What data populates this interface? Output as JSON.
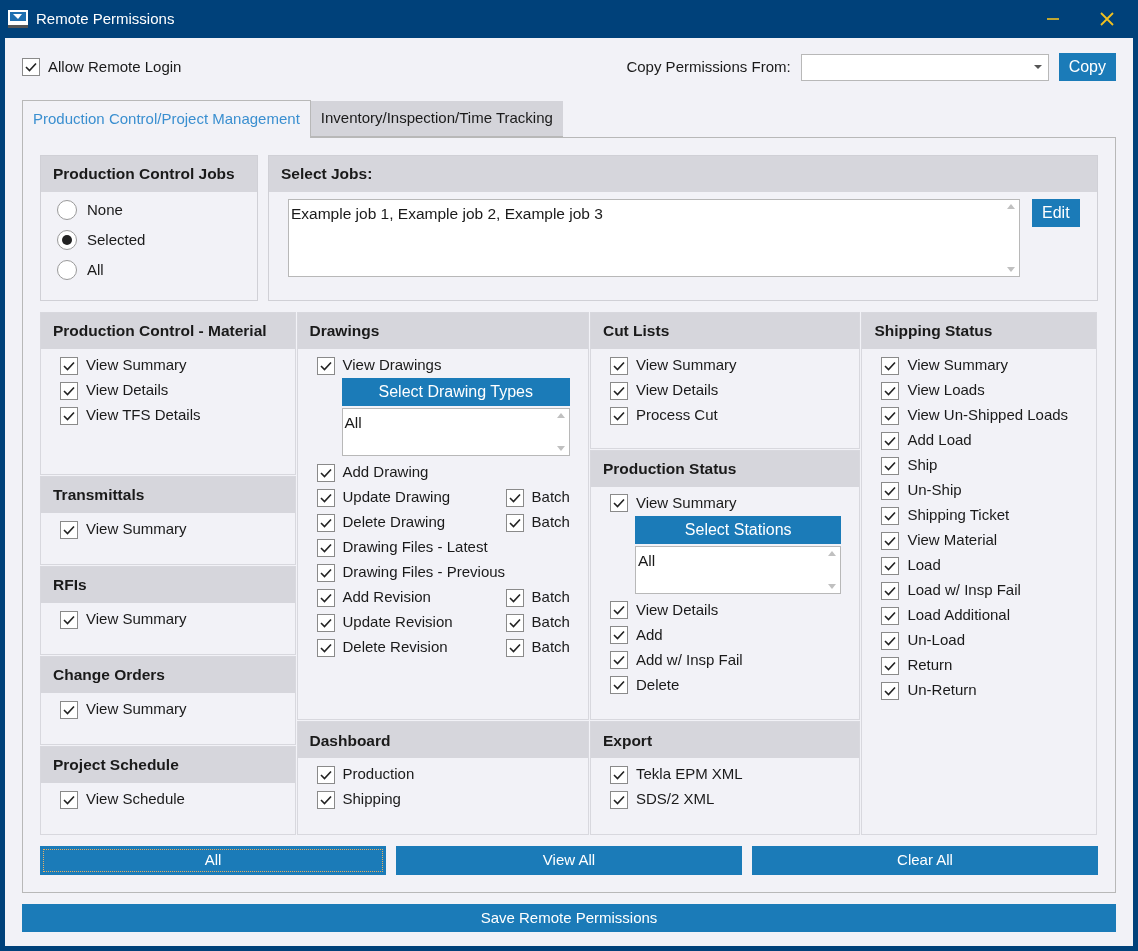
{
  "window": {
    "title": "Remote Permissions"
  },
  "allow_remote_login": {
    "label": "Allow Remote Login",
    "checked": true
  },
  "copy_permissions": {
    "label": "Copy Permissions From:",
    "button": "Copy"
  },
  "tabs": [
    {
      "label": "Production Control/Project Management",
      "selected": true
    },
    {
      "label": "Inventory/Inspection/Time Tracking",
      "selected": false
    }
  ],
  "jobs": {
    "title": "Production Control Jobs",
    "options": [
      {
        "label": "None",
        "selected": false
      },
      {
        "label": "Selected",
        "selected": true
      },
      {
        "label": "All",
        "selected": false
      }
    ]
  },
  "select_jobs": {
    "title": "Select Jobs:",
    "value": "Example job 1, Example job 2, Example job 3",
    "button": "Edit"
  },
  "columns": [
    {
      "sections": [
        {
          "title": "Production Control - Material",
          "items": [
            {
              "kind": "check",
              "label": "View Summary",
              "checked": true
            },
            {
              "kind": "check",
              "label": "View Details",
              "checked": true
            },
            {
              "kind": "check",
              "label": "View TFS Details",
              "checked": true
            }
          ]
        },
        {
          "title": "Transmittals",
          "items": [
            {
              "kind": "check",
              "label": "View Summary",
              "checked": true
            }
          ]
        },
        {
          "title": "RFIs",
          "items": [
            {
              "kind": "check",
              "label": "View Summary",
              "checked": true
            }
          ]
        },
        {
          "title": "Change Orders",
          "items": [
            {
              "kind": "check",
              "label": "View Summary",
              "checked": true
            }
          ]
        },
        {
          "title": "Project Schedule",
          "items": [
            {
              "kind": "check",
              "label": "View Schedule",
              "checked": true
            }
          ]
        }
      ]
    },
    {
      "sections": [
        {
          "title": "Drawings",
          "items": [
            {
              "kind": "check",
              "label": "View Drawings",
              "checked": true
            },
            {
              "kind": "picker",
              "button": "Select Drawing Types",
              "value": "All"
            },
            {
              "kind": "check",
              "label": "Add Drawing",
              "checked": true
            },
            {
              "kind": "check",
              "label": "Update Drawing",
              "checked": true,
              "batch": {
                "label": "Batch",
                "checked": true
              }
            },
            {
              "kind": "check",
              "label": "Delete Drawing",
              "checked": true,
              "batch": {
                "label": "Batch",
                "checked": true
              }
            },
            {
              "kind": "check",
              "label": "Drawing Files - Latest",
              "checked": true
            },
            {
              "kind": "check",
              "label": "Drawing Files - Previous",
              "checked": true
            },
            {
              "kind": "check",
              "label": "Add Revision",
              "checked": true,
              "batch": {
                "label": "Batch",
                "checked": true
              }
            },
            {
              "kind": "check",
              "label": "Update Revision",
              "checked": true,
              "batch": {
                "label": "Batch",
                "checked": true
              }
            },
            {
              "kind": "check",
              "label": "Delete Revision",
              "checked": true,
              "batch": {
                "label": "Batch",
                "checked": true
              }
            }
          ]
        },
        {
          "title": "Dashboard",
          "items": [
            {
              "kind": "check",
              "label": "Production",
              "checked": true
            },
            {
              "kind": "check",
              "label": "Shipping",
              "checked": true
            }
          ]
        }
      ]
    },
    {
      "sections": [
        {
          "title": "Cut Lists",
          "items": [
            {
              "kind": "check",
              "label": "View Summary",
              "checked": true
            },
            {
              "kind": "check",
              "label": "View Details",
              "checked": true
            },
            {
              "kind": "check",
              "label": "Process Cut",
              "checked": true
            }
          ]
        },
        {
          "title": "Production Status",
          "items": [
            {
              "kind": "check",
              "label": "View Summary",
              "checked": true
            },
            {
              "kind": "picker",
              "button": "Select Stations",
              "value": "All"
            },
            {
              "kind": "check",
              "label": "View Details",
              "checked": true
            },
            {
              "kind": "check",
              "label": "Add",
              "checked": true
            },
            {
              "kind": "check",
              "label": "Add w/ Insp Fail",
              "checked": true
            },
            {
              "kind": "check",
              "label": "Delete",
              "checked": true
            }
          ]
        },
        {
          "title": "Export",
          "items": [
            {
              "kind": "check",
              "label": "Tekla EPM XML",
              "checked": true
            },
            {
              "kind": "check",
              "label": "SDS/2 XML",
              "checked": true
            }
          ]
        }
      ]
    },
    {
      "sections": [
        {
          "title": "Shipping Status",
          "items": [
            {
              "kind": "check",
              "label": "View Summary",
              "checked": true
            },
            {
              "kind": "check",
              "label": "View Loads",
              "checked": true
            },
            {
              "kind": "check",
              "label": "View Un-Shipped Loads",
              "checked": true
            },
            {
              "kind": "check",
              "label": "Add Load",
              "checked": true
            },
            {
              "kind": "check",
              "label": "Ship",
              "checked": true
            },
            {
              "kind": "check",
              "label": "Un-Ship",
              "checked": true
            },
            {
              "kind": "check",
              "label": "Shipping Ticket",
              "checked": true
            },
            {
              "kind": "check",
              "label": "View Material",
              "checked": true
            },
            {
              "kind": "check",
              "label": "Load",
              "checked": true
            },
            {
              "kind": "check",
              "label": "Load w/ Insp Fail",
              "checked": true
            },
            {
              "kind": "check",
              "label": "Load Additional",
              "checked": true
            },
            {
              "kind": "check",
              "label": "Un-Load",
              "checked": true
            },
            {
              "kind": "check",
              "label": "Return",
              "checked": true
            },
            {
              "kind": "check",
              "label": "Un-Return",
              "checked": true
            }
          ]
        }
      ]
    }
  ],
  "bulk_buttons": [
    {
      "label": "All",
      "focused": true
    },
    {
      "label": "View All",
      "focused": false
    },
    {
      "label": "Clear All",
      "focused": false
    }
  ],
  "save_button": "Save Remote Permissions"
}
